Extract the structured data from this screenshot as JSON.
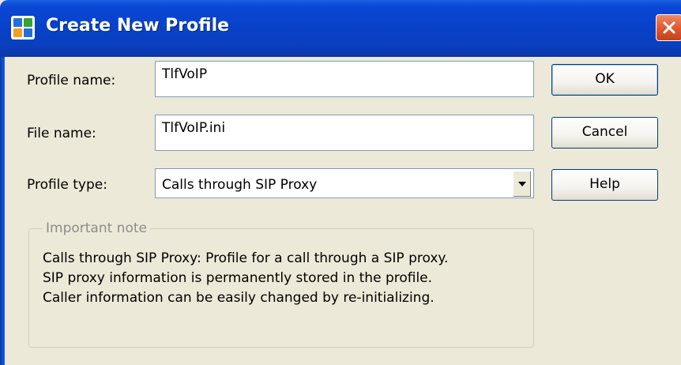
{
  "window": {
    "title": "Create New Profile",
    "icons": {
      "app": "app-logo-icon",
      "close": "close-icon"
    },
    "colors": {
      "titlebar": "#0742c9",
      "close_button": "#e05a30",
      "client": "#ece9d8"
    }
  },
  "form": {
    "profile_name": {
      "label": "Profile name:",
      "value": "TlfVoIP"
    },
    "file_name": {
      "label": "File name:",
      "value": "TlfVoIP.ini"
    },
    "profile_type": {
      "label": "Profile type:",
      "value": "Calls through SIP Proxy",
      "icon": "chevron-down-icon"
    }
  },
  "buttons": {
    "ok": "OK",
    "cancel": "Cancel",
    "help": "Help"
  },
  "note": {
    "legend": "Important note",
    "lines": [
      "Calls through SIP Proxy: Profile for a call through a SIP proxy.",
      "SIP proxy information is permanently stored in the profile.",
      "Caller information can be easily changed by re-initializing."
    ]
  }
}
